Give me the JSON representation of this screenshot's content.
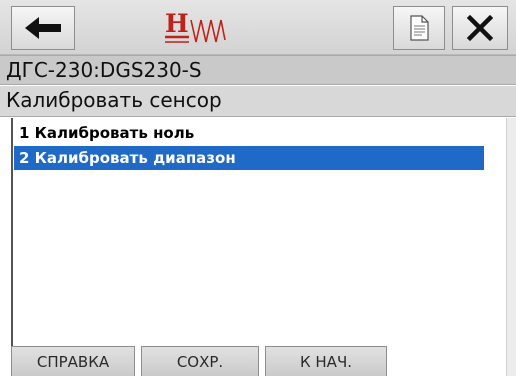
{
  "header": {
    "icons": {
      "back": "arrow-left-icon",
      "logo": "hw-logo",
      "document": "document-icon",
      "close": "close-icon"
    },
    "title": "ДГС-230:DGS230-S",
    "subtitle": "Калибровать сенсор"
  },
  "menu": {
    "items": [
      {
        "label": "1 Калибровать ноль",
        "selected": false
      },
      {
        "label": "2 Калибровать диапазон",
        "selected": true
      }
    ]
  },
  "footer": {
    "help_label": "СПРАВКА",
    "save_label": "СОХР.",
    "home_label": "К НАЧ."
  },
  "colors": {
    "selection": "#1f69c7",
    "logo_red": "#c0211a"
  }
}
